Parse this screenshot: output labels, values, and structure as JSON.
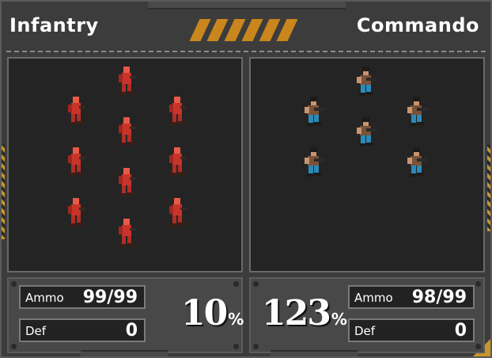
{
  "left_side": {
    "name": "Infantry",
    "unit_icon": "red-infantry-soldier-icon",
    "unit_color": "#c8342a",
    "ammo_label": "Ammo",
    "ammo_value": "99/99",
    "def_label": "Def",
    "def_value": "0",
    "percent": "10",
    "percent_sign": "%"
  },
  "right_side": {
    "name": "Commando",
    "unit_icon": "commando-soldier-icon",
    "unit_color": "#2a8ab8",
    "ammo_label": "Ammo",
    "ammo_value": "98/99",
    "def_label": "Def",
    "def_value": "0",
    "percent": "123",
    "percent_sign": "%"
  },
  "accent_color": "#c8861c"
}
